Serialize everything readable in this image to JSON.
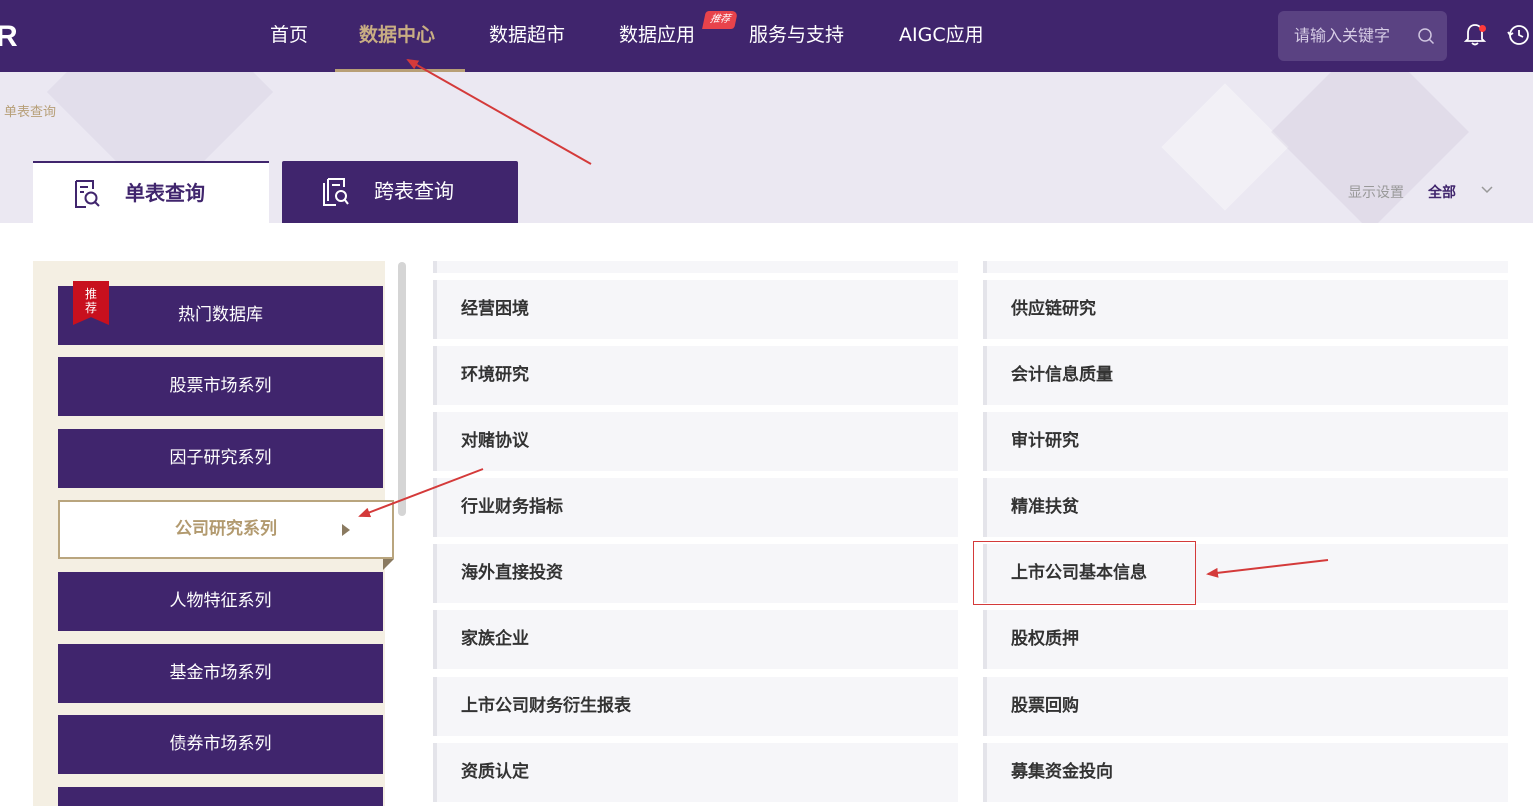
{
  "nav": {
    "logo": "R",
    "items": [
      {
        "label": "首页"
      },
      {
        "label": "数据中心"
      },
      {
        "label": "数据超市"
      },
      {
        "label": "数据应用"
      },
      {
        "label": "服务与支持"
      },
      {
        "label": "AIGC应用"
      }
    ],
    "active_index": 1,
    "hot_badge": "推荐",
    "search_placeholder": "请输入关键字"
  },
  "breadcrumb": "单表查询",
  "tabs": [
    {
      "label": "单表查询",
      "active": true
    },
    {
      "label": "跨表查询",
      "active": false
    }
  ],
  "display_settings": {
    "label": "显示设置",
    "value": "全部"
  },
  "sidebar": {
    "badge": "推荐",
    "items": [
      {
        "label": "热门数据库"
      },
      {
        "label": "股票市场系列"
      },
      {
        "label": "因子研究系列"
      },
      {
        "label": "公司研究系列"
      },
      {
        "label": "人物特征系列"
      },
      {
        "label": "基金市场系列"
      },
      {
        "label": "债券市场系列"
      }
    ],
    "active_index": 3
  },
  "grid": {
    "left": [
      {
        "label": "经营困境"
      },
      {
        "label": "环境研究"
      },
      {
        "label": "对赌协议"
      },
      {
        "label": "行业财务指标"
      },
      {
        "label": "海外直接投资"
      },
      {
        "label": "家族企业"
      },
      {
        "label": "上市公司财务衍生报表"
      },
      {
        "label": "资质认定"
      }
    ],
    "right": [
      {
        "label": "供应链研究"
      },
      {
        "label": "会计信息质量"
      },
      {
        "label": "审计研究"
      },
      {
        "label": "精准扶贫"
      },
      {
        "label": "上市公司基本信息"
      },
      {
        "label": "股权质押"
      },
      {
        "label": "股票回购"
      },
      {
        "label": "募集资金投向"
      }
    ],
    "highlighted": "上市公司基本信息"
  },
  "colors": {
    "primary": "#40256d",
    "gold": "#c9ae83",
    "annotation_red": "#d43a3a"
  }
}
